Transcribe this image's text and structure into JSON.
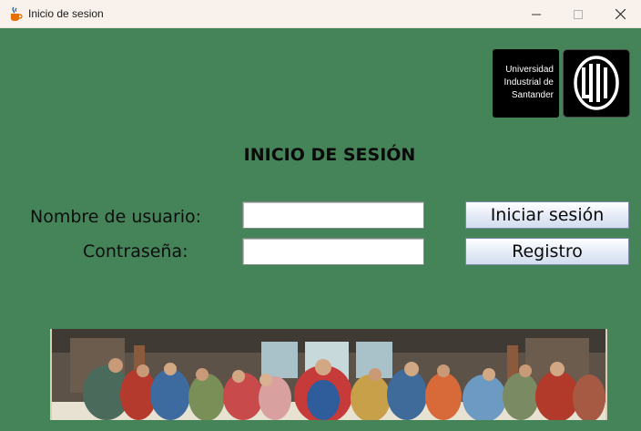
{
  "window": {
    "title": "Inicio de sesion",
    "icon": "java-cup-icon",
    "controls": [
      "minimize-icon",
      "maximize-icon",
      "close-icon"
    ]
  },
  "logo": {
    "line1": "Universidad",
    "line2": "Industrial de",
    "line3": "Santander",
    "mark": "UIS"
  },
  "heading": "INICIO DE SESIÓN",
  "form": {
    "username_label": "Nombre de usuario:",
    "username_value": "",
    "password_label": "Contraseña:",
    "password_value": ""
  },
  "buttons": {
    "login": "Iniciar sesión",
    "register": "Registro"
  },
  "colors": {
    "background": "#458459",
    "titlebar": "#f8f1ec",
    "button_face": "#e6ecf7"
  }
}
